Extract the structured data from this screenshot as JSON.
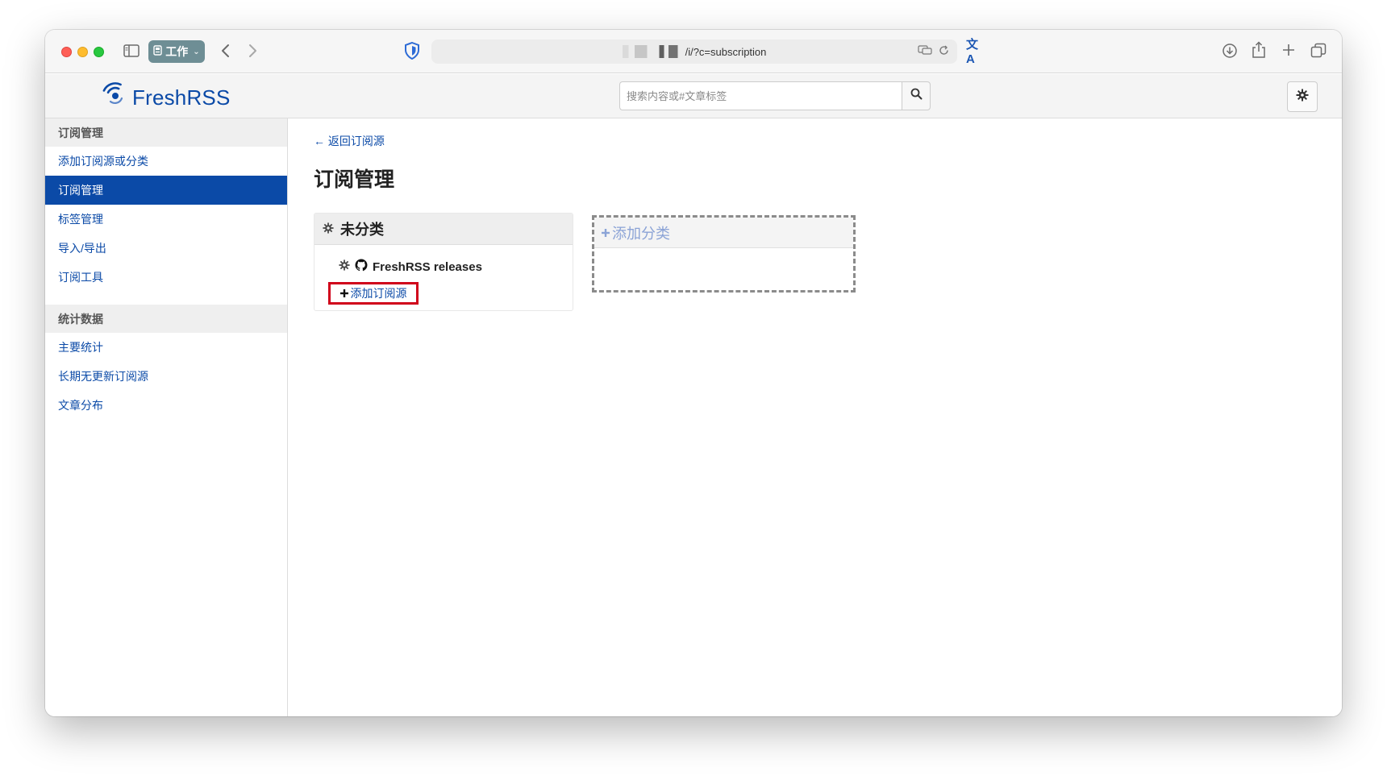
{
  "browser": {
    "profile_label": "工作",
    "url_text": "/i/?c=subscription",
    "translate_label": "文A"
  },
  "app": {
    "logo_text": "FreshRSS",
    "search_placeholder": "搜索内容或#文章标签"
  },
  "sidebar": {
    "group1_title": "订阅管理",
    "group1_items": [
      {
        "label": "添加订阅源或分类"
      },
      {
        "label": "订阅管理",
        "active": true
      },
      {
        "label": "标签管理"
      },
      {
        "label": "导入/导出"
      },
      {
        "label": "订阅工具"
      }
    ],
    "group2_title": "统计数据",
    "group2_items": [
      {
        "label": "主要统计"
      },
      {
        "label": "长期无更新订阅源"
      },
      {
        "label": "文章分布"
      }
    ]
  },
  "main": {
    "back_link": "← 返回订阅源",
    "page_title": "订阅管理",
    "category_name": "未分类",
    "feed_name": "FreshRSS releases",
    "add_feed_label": "添加订阅源",
    "add_category_label": "添加分类"
  },
  "colors": {
    "accent": "#0b4aa7",
    "highlight_border": "#d0021b"
  }
}
